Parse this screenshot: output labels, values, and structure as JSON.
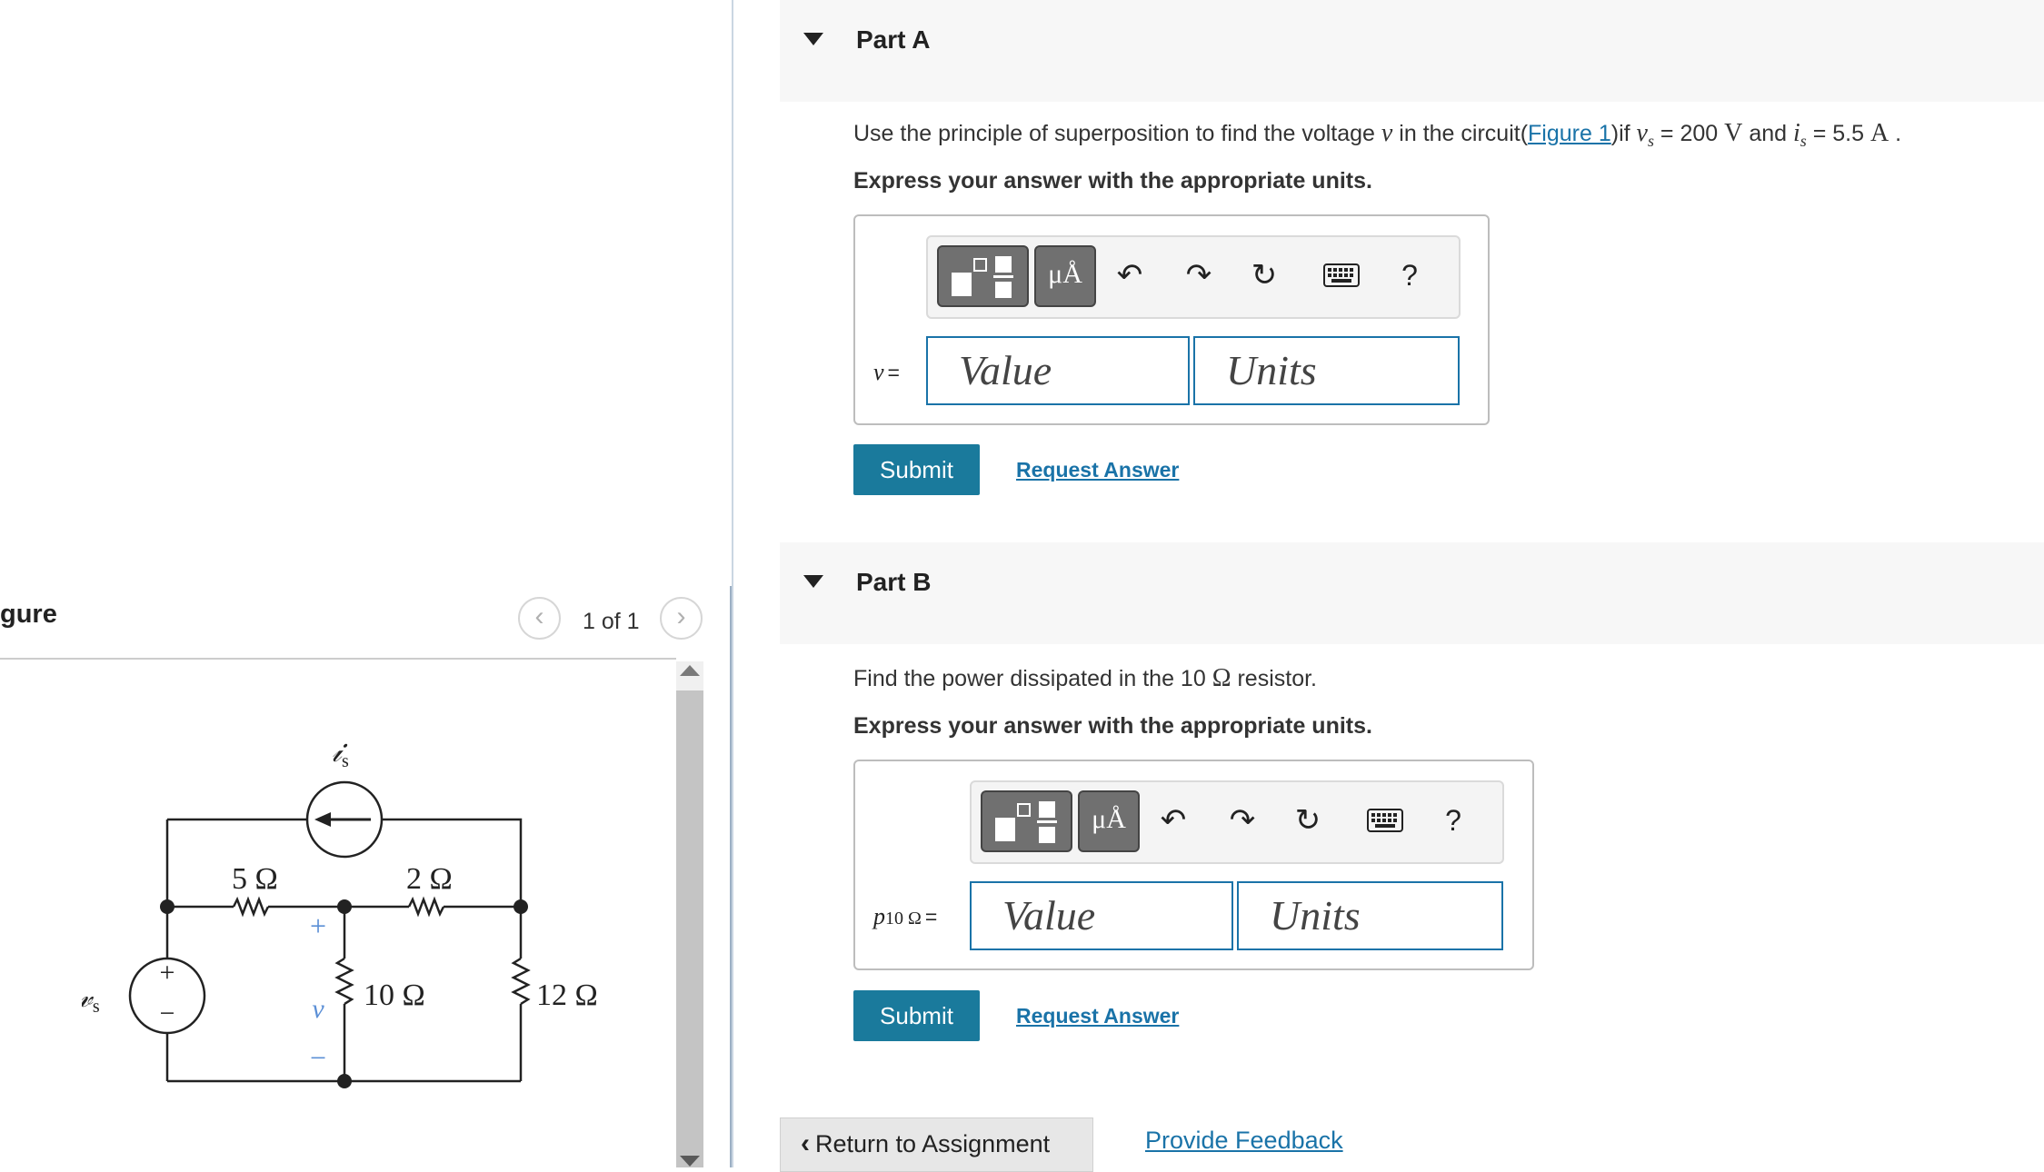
{
  "figure_panel": {
    "title": "gure",
    "pager_prev_icon": "chevron-left-icon",
    "pager_next_icon": "chevron-right-icon",
    "pager_count": "1 of 1",
    "circuit": {
      "source_voltage_label": "v_s",
      "source_current_label": "i_s",
      "resistor_5": "5 Ω",
      "resistor_2": "2 Ω",
      "resistor_10": "10 Ω",
      "resistor_12": "12 Ω",
      "voltage_label": "v",
      "plus": "+",
      "minus": "−"
    }
  },
  "partA": {
    "title": "Part A",
    "question_prefix": "Use the principle of superposition to find the voltage ",
    "question_var": "v",
    "question_mid": " in the circuit(",
    "figure_link": "Figure 1",
    "question_after_link": ")if ",
    "vs_var": "v",
    "vs_sub": "s",
    "vs_value": " = 200 ",
    "vs_unit": "V",
    "and_text": " and ",
    "is_var": "i",
    "is_sub": "s",
    "is_value": " = 5.5 ",
    "is_unit": "A",
    "period": " .",
    "instruction": "Express your answer with the appropriate units.",
    "units_button": "μÅ",
    "undo_icon": "undo-icon",
    "redo_icon": "redo-icon",
    "reset_icon": "reset-icon",
    "keyboard_icon": "keyboard-icon",
    "help_label": "?",
    "variable": "v",
    "equals": "=",
    "value_placeholder": "Value",
    "units_placeholder": "Units",
    "submit_label": "Submit",
    "request_label": "Request Answer"
  },
  "partB": {
    "title": "Part B",
    "question_prefix": "Find the power dissipated in the 10 ",
    "question_unit": "Ω",
    "question_suffix": " resistor.",
    "instruction": "Express your answer with the appropriate units.",
    "units_button": "μÅ",
    "help_label": "?",
    "variable": "p",
    "variable_sub": "10 Ω",
    "equals": "=",
    "value_placeholder": "Value",
    "units_placeholder": "Units",
    "submit_label": "Submit",
    "request_label": "Request Answer"
  },
  "footer": {
    "return_label": "Return to Assignment",
    "feedback_label": "Provide Feedback"
  },
  "colors": {
    "accent": "#1a7a9c",
    "link": "#1a73a8",
    "header_bg": "#f7f7f7"
  }
}
